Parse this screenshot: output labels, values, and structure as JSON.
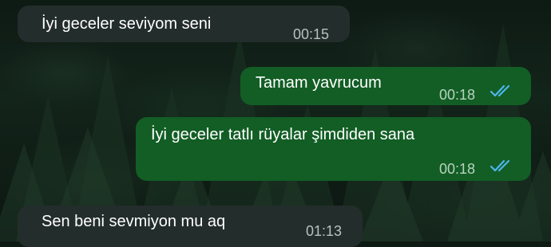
{
  "chat": {
    "messages": [
      {
        "direction": "incoming",
        "text": "İyi geceler seviyom seni",
        "time": "00:15"
      },
      {
        "direction": "outgoing",
        "text": "Tamam yavrucum",
        "time": "00:18",
        "status_icon": "double-check-read-icon"
      },
      {
        "direction": "outgoing",
        "text": "İyi geceler tatlı rüyalar şimdiden sana",
        "time": "00:18",
        "status_icon": "double-check-read-icon"
      },
      {
        "direction": "incoming",
        "text": "Sen beni sevmiyon mu aq",
        "time": "01:13"
      }
    ]
  },
  "colors": {
    "incoming_bubble": "#232d2b",
    "outgoing_bubble": "#125e25",
    "read_ticks": "#4fb6ec"
  }
}
